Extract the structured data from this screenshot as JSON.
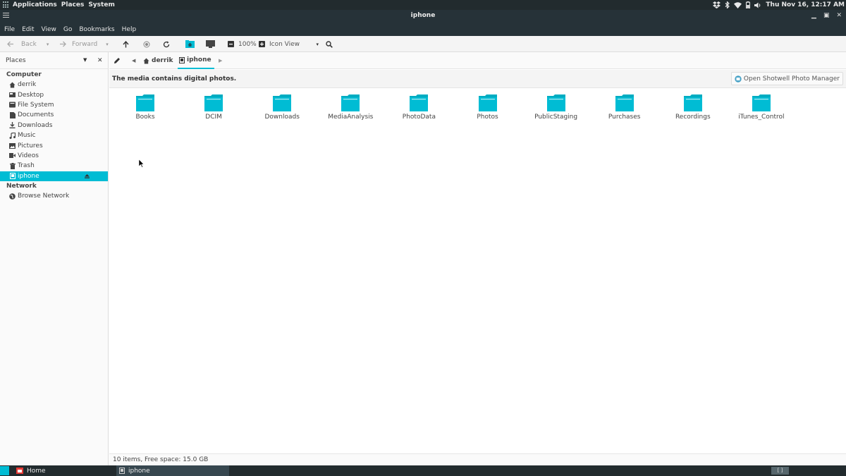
{
  "top_panel": {
    "menus": [
      "Applications",
      "Places",
      "System"
    ],
    "clock": "Thu Nov 16, 12:17 AM",
    "tray_icons": [
      "dropbox-icon",
      "bluetooth-icon",
      "wifi-icon",
      "battery-icon",
      "volume-icon"
    ]
  },
  "window": {
    "title": "iphone",
    "controls": [
      "minimize",
      "maximize",
      "close"
    ]
  },
  "menubar": [
    "File",
    "Edit",
    "View",
    "Go",
    "Bookmarks",
    "Help"
  ],
  "toolbar": {
    "back_label": "Back",
    "forward_label": "Forward",
    "zoom": "100%",
    "view_mode": "Icon View"
  },
  "sidebar": {
    "header": "Places",
    "sections": [
      {
        "title": "Computer",
        "items": [
          {
            "label": "derrik",
            "icon": "home-icon"
          },
          {
            "label": "Desktop",
            "icon": "desktop-icon"
          },
          {
            "label": "File System",
            "icon": "harddisk-icon"
          },
          {
            "label": "Documents",
            "icon": "document-icon"
          },
          {
            "label": "Downloads",
            "icon": "download-icon"
          },
          {
            "label": "Music",
            "icon": "music-icon"
          },
          {
            "label": "Pictures",
            "icon": "picture-icon"
          },
          {
            "label": "Videos",
            "icon": "video-icon"
          },
          {
            "label": "Trash",
            "icon": "trash-icon"
          },
          {
            "label": "iphone",
            "icon": "phone-icon",
            "active": true
          }
        ]
      },
      {
        "title": "Network",
        "items": [
          {
            "label": "Browse Network",
            "icon": "network-icon"
          }
        ]
      }
    ]
  },
  "pathbar": {
    "crumbs": [
      {
        "label": "derrik",
        "icon": "home-icon"
      },
      {
        "label": "iphone",
        "icon": "phone-icon",
        "current": true
      }
    ]
  },
  "infobar": {
    "message": "The media contains digital photos.",
    "button": "Open Shotwell Photo Manager"
  },
  "folders": [
    "Books",
    "DCIM",
    "Downloads",
    "MediaAnalysis",
    "PhotoData",
    "Photos",
    "PublicStaging",
    "Purchases",
    "Recordings",
    "iTunes_Control"
  ],
  "status": "10 items, Free space: 15.0 GB",
  "taskbar": {
    "tasks": [
      {
        "label": "Home",
        "active": false
      },
      {
        "label": "iphone",
        "active": true
      }
    ],
    "workspace": "[ ]"
  },
  "colors": {
    "accent": "#00bcd4",
    "panel": "#222b2e",
    "titlebar": "#263238"
  }
}
